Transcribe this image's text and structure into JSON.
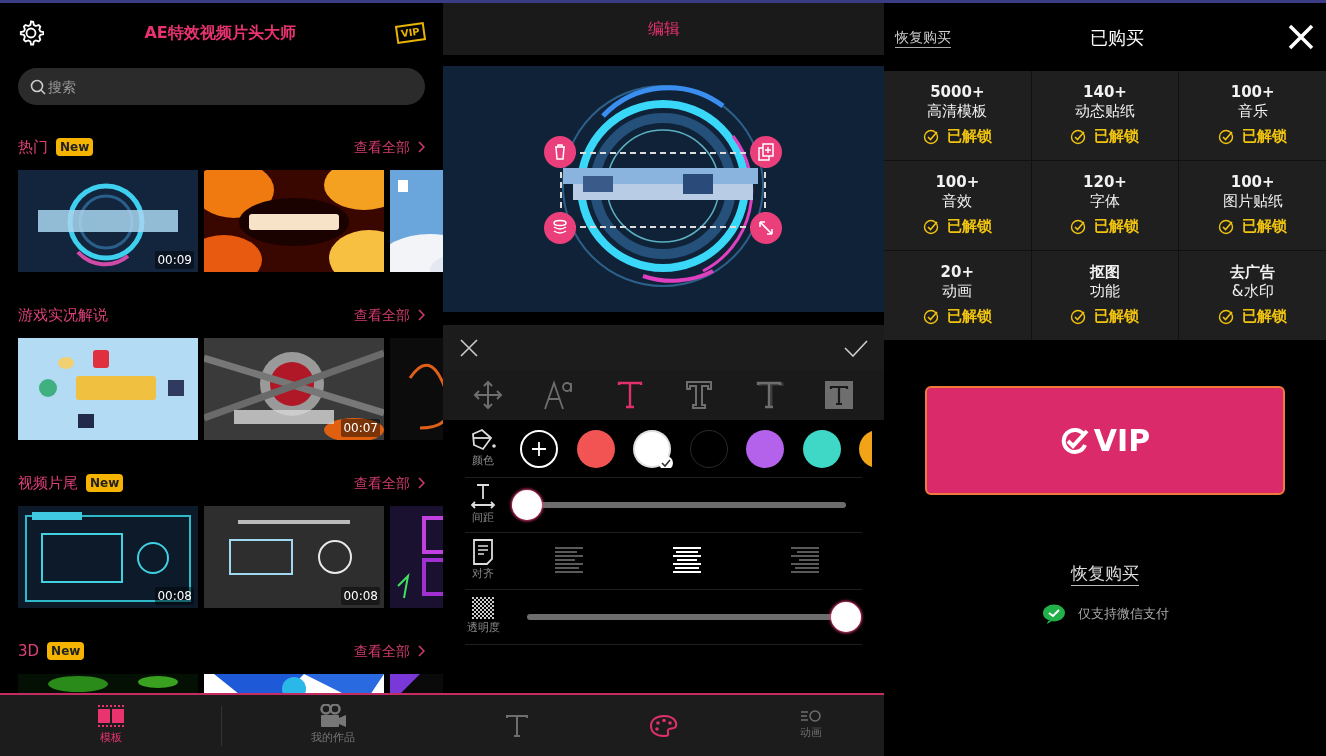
{
  "home": {
    "title": "AE特效视频片头大师",
    "vip_badge": "VIP",
    "search": {
      "placeholder": "搜索"
    },
    "sections": [
      {
        "title": "热门",
        "new_label": "New",
        "more": "查看全部",
        "thumbnails": [
          {
            "kind": "picture",
            "duration": "00:09"
          },
          {
            "kind": "picture"
          },
          {
            "kind": "picture"
          }
        ]
      },
      {
        "title": "游戏实况解说",
        "more": "查看全部",
        "thumbnails": [
          {
            "kind": "picture"
          },
          {
            "kind": "picture",
            "duration": "00:07"
          },
          {
            "kind": "picture"
          }
        ]
      },
      {
        "title": "视频片尾",
        "new_label": "New",
        "more": "查看全部",
        "thumbnails": [
          {
            "kind": "picture",
            "duration": "00:08"
          },
          {
            "kind": "picture",
            "duration": "00:08"
          },
          {
            "kind": "picture"
          }
        ]
      },
      {
        "title": "3D",
        "new_label": "New",
        "more": "查看全部",
        "thumbnails": [
          {
            "kind": "picture"
          },
          {
            "kind": "picture"
          },
          {
            "kind": "picture"
          }
        ]
      }
    ],
    "nav": [
      {
        "kind": "film",
        "label": "模板",
        "selected": true
      },
      {
        "kind": "camera",
        "label": "我的作品",
        "selected": false
      }
    ]
  },
  "editor": {
    "title": "编辑",
    "tools": [
      {
        "kind": "move",
        "selected": false
      },
      {
        "kind": "size",
        "selected": false
      },
      {
        "kind": "plain",
        "selected": true
      },
      {
        "kind": "outline",
        "selected": false
      },
      {
        "kind": "shadow",
        "selected": false
      },
      {
        "kind": "boxed",
        "selected": false
      }
    ],
    "properties": [
      {
        "kind": "colors",
        "label": "颜色",
        "swatches": [
          {
            "kind": "add",
            "selected": false
          },
          {
            "kind": "color",
            "color": "#f25353",
            "selected": false
          },
          {
            "kind": "color",
            "color": "#ffffff",
            "selected": true
          },
          {
            "kind": "color",
            "color": "#000000",
            "selected": false
          },
          {
            "kind": "color",
            "color": "#b462ec",
            "selected": false
          },
          {
            "kind": "color",
            "color": "#3fd8c6",
            "selected": false
          },
          {
            "kind": "color",
            "color": "#f2a418",
            "selected": false
          }
        ]
      },
      {
        "kind": "spacing",
        "label": "间距",
        "level": 0
      },
      {
        "kind": "align",
        "label": "对齐",
        "options": [
          {
            "kind": "left",
            "selected": false
          },
          {
            "kind": "center",
            "selected": true
          },
          {
            "kind": "right",
            "selected": false
          }
        ]
      },
      {
        "kind": "opacity",
        "label": "透明度",
        "level": 1
      }
    ],
    "tabs": [
      {
        "kind": "text",
        "selected": false
      },
      {
        "kind": "palette",
        "selected": true
      },
      {
        "kind": "animation",
        "label": "动画",
        "selected": false
      }
    ]
  },
  "purchase": {
    "restore": "恢复购买",
    "title": "已购买",
    "features": [
      {
        "lines": [
          "5000+",
          "高清模板"
        ],
        "status": "已解锁",
        "unlocked": true
      },
      {
        "lines": [
          "140+",
          "动态贴纸"
        ],
        "status": "已解锁",
        "unlocked": true
      },
      {
        "lines": [
          "100+",
          "音乐"
        ],
        "status": "已解锁",
        "unlocked": true
      },
      {
        "lines": [
          "100+",
          "音效"
        ],
        "status": "已解锁",
        "unlocked": true
      },
      {
        "lines": [
          "120+",
          "字体"
        ],
        "status": "已解锁",
        "unlocked": true
      },
      {
        "lines": [
          "100+",
          "图片贴纸"
        ],
        "status": "已解锁",
        "unlocked": true
      },
      {
        "lines": [
          "20+",
          "动画"
        ],
        "status": "已解锁",
        "unlocked": true
      },
      {
        "lines": [
          "抠图",
          "功能"
        ],
        "status": "已解锁",
        "unlocked": true
      },
      {
        "lines": [
          "去广告",
          "&水印"
        ],
        "status": "已解锁",
        "unlocked": true
      }
    ],
    "vip_button": "VIP",
    "restore_link": "恢复购买",
    "payment_note": "仅支持微信支付"
  }
}
